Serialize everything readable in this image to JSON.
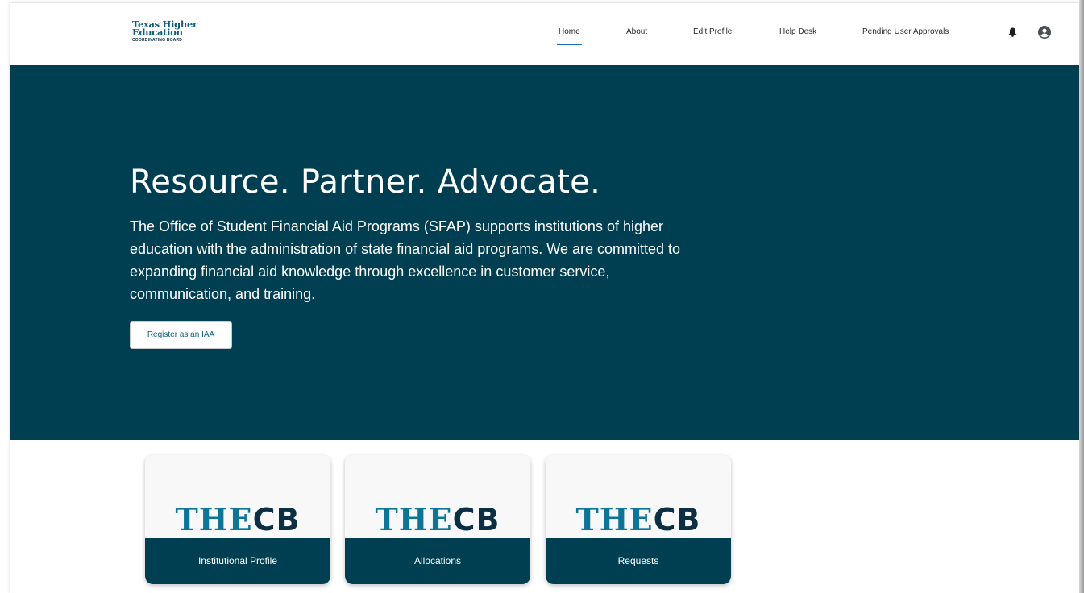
{
  "header": {
    "logo_line1": "Texas Higher",
    "logo_line2": "Education",
    "logo_line3": "COORDINATING BOARD",
    "nav": [
      {
        "label": "Home",
        "active": true
      },
      {
        "label": "About"
      },
      {
        "label": "Edit Profile"
      },
      {
        "label": "Help Desk"
      },
      {
        "label": "Pending User Approvals"
      }
    ],
    "icons": [
      "bell-icon",
      "user-avatar-icon"
    ]
  },
  "hero": {
    "title": "Resource. Partner. Advocate.",
    "text": "The Office of Student Financial Aid Programs (SFAP) supports institutions of higher education with the administration of state financial aid programs. We are committed to expanding financial aid knowledge through excellence in customer service, communication, and training.",
    "button_label": "Register as an IAA"
  },
  "cards": [
    {
      "logo_part1": "THE",
      "logo_part2": "CB",
      "label": "Institutional Profile"
    },
    {
      "logo_part1": "THE",
      "logo_part2": "CB",
      "label": "Allocations"
    },
    {
      "logo_part1": "THE",
      "logo_part2": "CB",
      "label": "Requests"
    }
  ],
  "colors": {
    "hero_bg": "#003f52",
    "accent": "#1b6fb3",
    "brand_teal": "#0f7597",
    "brand_dark": "#0c2f44"
  }
}
